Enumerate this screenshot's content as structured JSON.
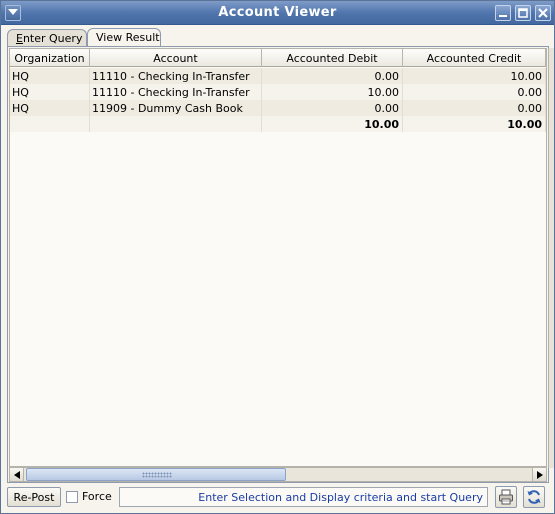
{
  "window": {
    "title": "Account Viewer"
  },
  "tabs": [
    {
      "label": "Enter Query",
      "mnemonic": "E",
      "rest": "nter Query"
    },
    {
      "label": "View Result"
    }
  ],
  "table": {
    "columns": [
      "Organization",
      "Account",
      "Accounted Debit",
      "Accounted Credit"
    ],
    "rows": [
      [
        "HQ",
        "11110 - Checking In-Transfer",
        "0.00",
        "10.00"
      ],
      [
        "HQ",
        "11110 - Checking In-Transfer",
        "10.00",
        "0.00"
      ],
      [
        "HQ",
        "11909 - Dummy Cash Book",
        "0.00",
        "0.00"
      ]
    ],
    "total": [
      "",
      "",
      "10.00",
      "10.00"
    ]
  },
  "bottom": {
    "repost_label": "Re-Post",
    "force_label": "Force",
    "force_checked": false,
    "status_text": "Enter Selection and Display criteria and start Query"
  },
  "icons": {
    "window_menu": "window-menu-icon",
    "minimize": "minimize-icon",
    "maximize": "maximize-icon",
    "close": "close-icon",
    "print": "print-icon",
    "refresh": "refresh-icon"
  },
  "colors": {
    "titlebar": "#5176ad",
    "status_text": "#1a3ca5",
    "row_odd": "#efebe0",
    "row_even": "#f6f3ec"
  }
}
